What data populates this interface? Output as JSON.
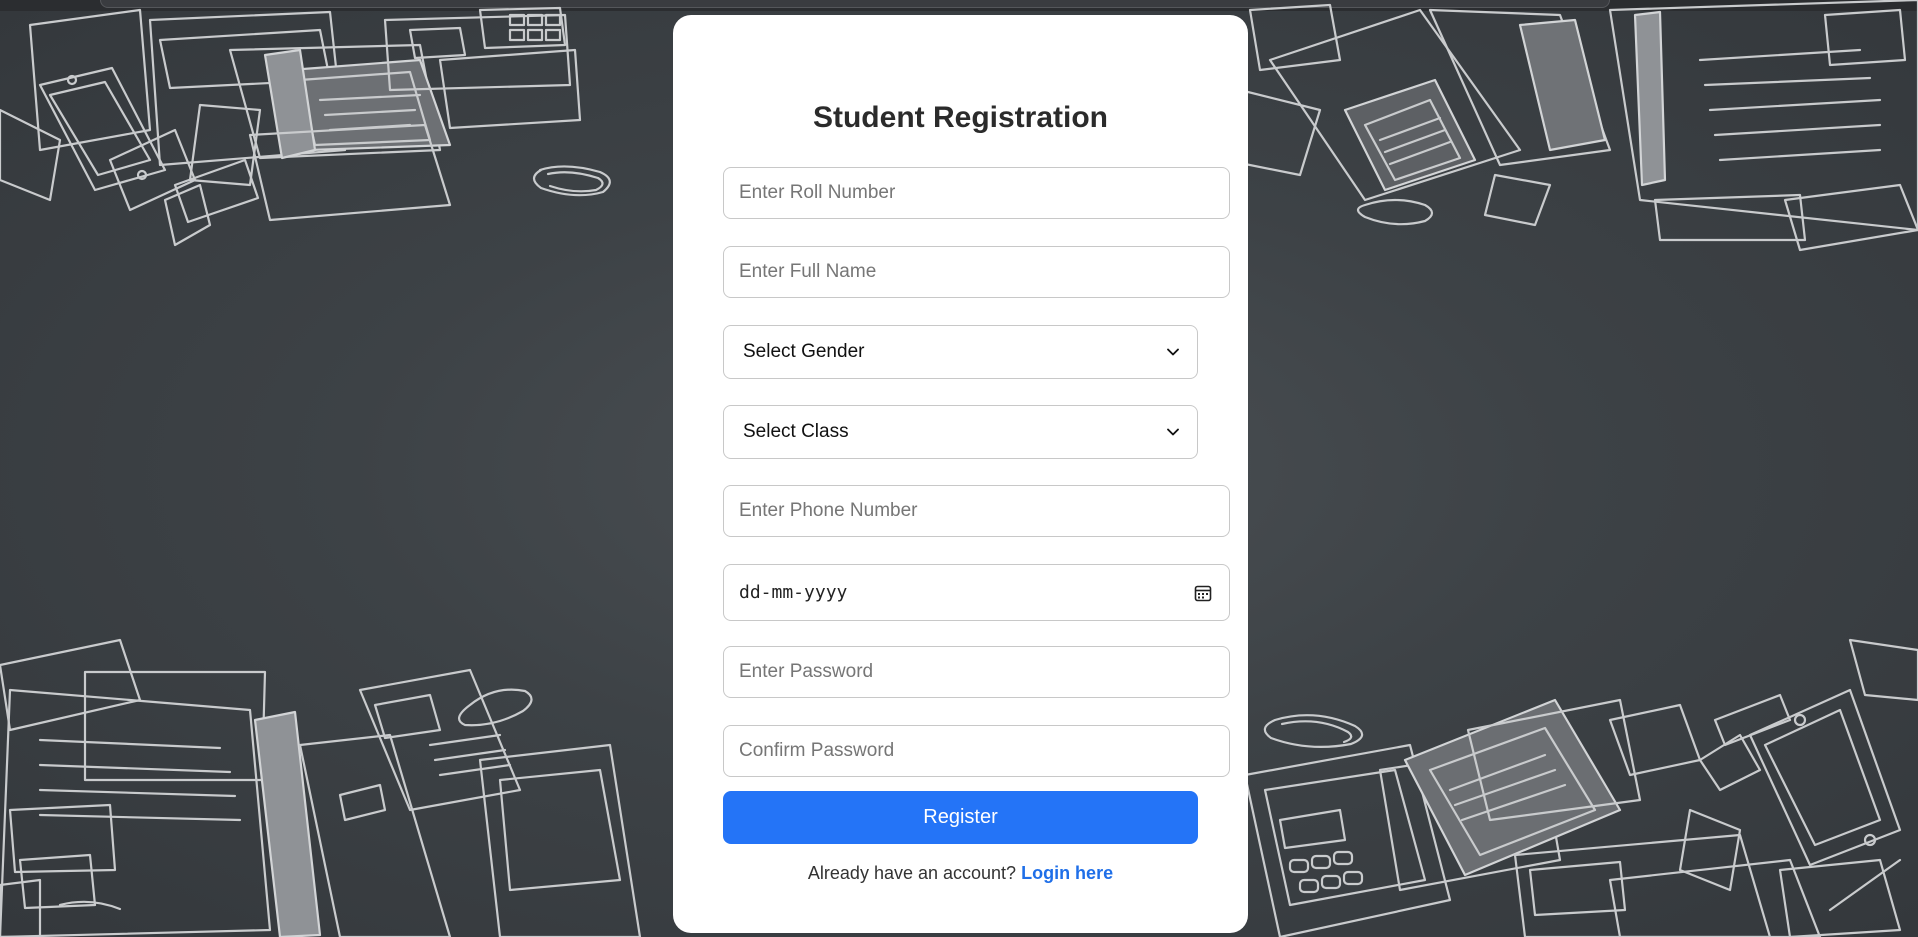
{
  "form": {
    "title": "Student Registration",
    "roll_number_placeholder": "Enter Roll Number",
    "full_name_placeholder": "Enter Full Name",
    "gender_selected": "Select Gender",
    "class_selected": "Select Class",
    "phone_placeholder": "Enter Phone Number",
    "dob_placeholder": "dd-mm-yyyy",
    "password_placeholder": "Enter Password",
    "confirm_password_placeholder": "Confirm Password",
    "register_label": "Register",
    "login_prompt": "Already have an account?",
    "login_link": "Login here"
  },
  "icons": {
    "select_arrow": "chevron-down-icon",
    "date_picker": "calendar-icon"
  },
  "colors": {
    "primary": "#2474f7",
    "link": "#1f6fe8",
    "background": "#3d4246",
    "card": "#ffffff"
  }
}
